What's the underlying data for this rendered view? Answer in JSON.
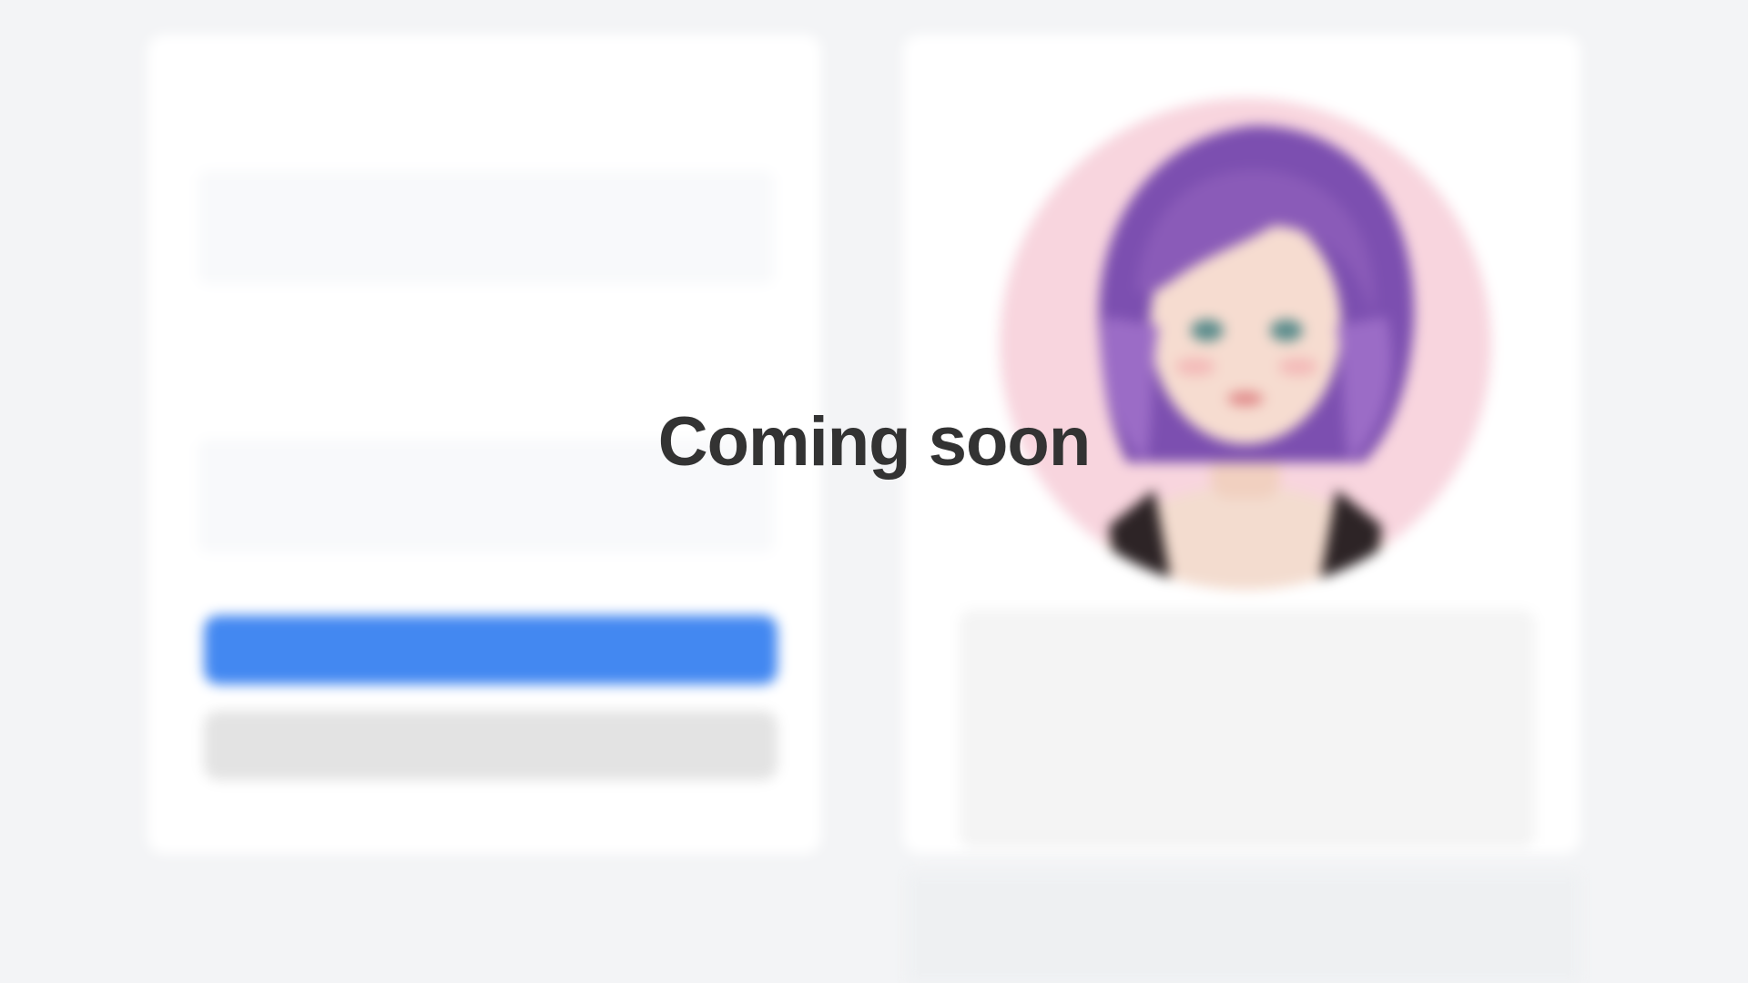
{
  "overlay": {
    "message": "Coming soon"
  },
  "form": {
    "sections": [
      {
        "title": "",
        "label": "",
        "placeholder": ""
      },
      {
        "title": "",
        "label": "",
        "placeholder": ""
      }
    ],
    "primary_button_label": "",
    "secondary_button_label": ""
  },
  "colors": {
    "background": "#f3f4f6",
    "card": "#ffffff",
    "primary_button": "#4388f1",
    "secondary_button": "#e3e3e3",
    "avatar_background": "#f8d5de",
    "hair": "#8a5bb8",
    "overlay_text": "#333333"
  },
  "icons": {
    "avatar": "anime-portrait-purple-hair"
  }
}
